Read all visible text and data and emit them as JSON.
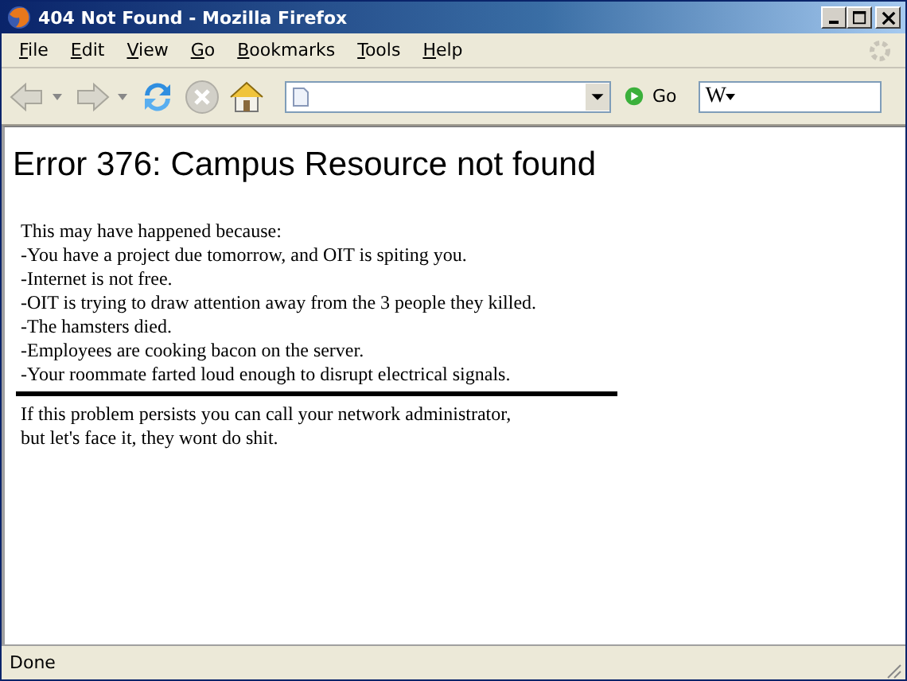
{
  "window": {
    "title": "404 Not Found - Mozilla Firefox"
  },
  "menu": [
    "File",
    "Edit",
    "View",
    "Go",
    "Bookmarks",
    "Tools",
    "Help"
  ],
  "toolbar": {
    "go_label": "Go",
    "search_engine": "W"
  },
  "page": {
    "heading": "Error 376: Campus Resource not found",
    "intro": "This may have happened because:",
    "reasons": [
      "-You have a project due tomorrow, and OIT is spiting you.",
      "-Internet is not free.",
      "-OIT is trying to draw attention away from the 3 people they killed.",
      "-The hamsters died.",
      "-Employees are cooking bacon on the server.",
      "-Your roommate farted loud enough to disrupt electrical signals."
    ],
    "footer": [
      "If this problem persists you can call your network administrator,",
      "but let's face it, they wont do shit."
    ]
  },
  "status_bar": {
    "text": "Done"
  }
}
